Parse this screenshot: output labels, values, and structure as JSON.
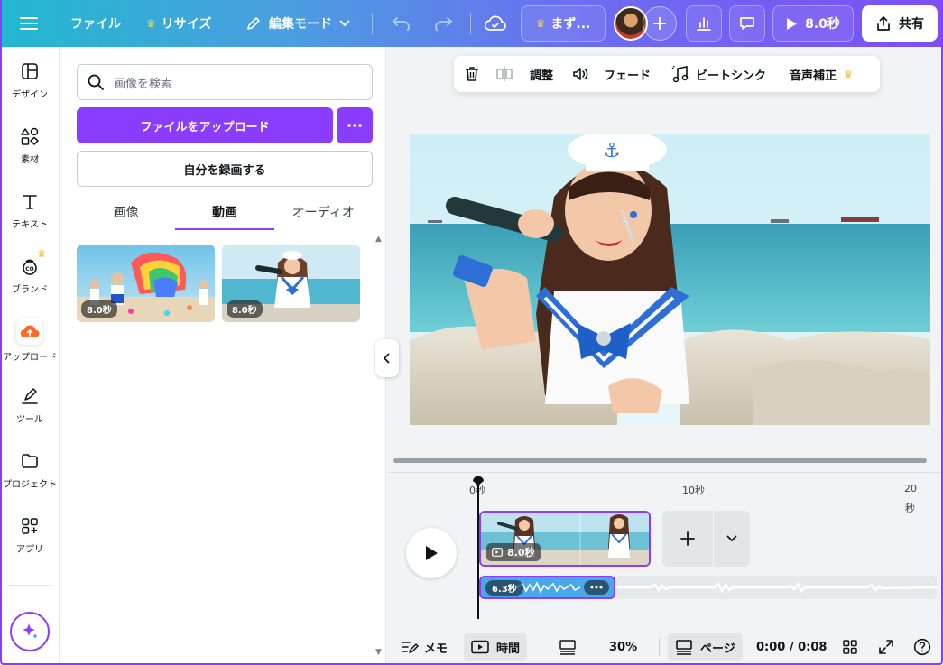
{
  "topbar": {
    "file": "ファイル",
    "resize": "リサイズ",
    "edit_mode": "編集モード",
    "design_title": "まず...",
    "duration": "8.0秒",
    "share": "共有"
  },
  "rail": {
    "items": [
      {
        "label": "デザイン",
        "icon": "layout-icon"
      },
      {
        "label": "素材",
        "icon": "shapes-icon"
      },
      {
        "label": "テキスト",
        "icon": "text-icon"
      },
      {
        "label": "ブランド",
        "icon": "brand-icon"
      },
      {
        "label": "アップロード",
        "icon": "upload-cloud-icon"
      },
      {
        "label": "ツール",
        "icon": "pen-tool-icon"
      },
      {
        "label": "プロジェクト",
        "icon": "folder-icon"
      },
      {
        "label": "アプリ",
        "icon": "apps-icon"
      }
    ]
  },
  "panel": {
    "search_placeholder": "画像を検索",
    "upload_button": "ファイルをアップロード",
    "record_button": "自分を録画する",
    "tabs": [
      {
        "label": "画像"
      },
      {
        "label": "動画"
      },
      {
        "label": "オーディオ"
      }
    ],
    "active_tab": "動画",
    "videos": [
      {
        "duration": "8.0秒"
      },
      {
        "duration": "8.0秒"
      }
    ]
  },
  "context_toolbar": {
    "adjust": "調整",
    "fade": "フェード",
    "beat_sync": "ビートシンク",
    "audio_enhance": "音声補正"
  },
  "timeline": {
    "ticks": [
      "0秒",
      "10秒",
      "20",
      "秒"
    ],
    "video_clip_duration": "8.0秒",
    "audio_clip_duration": "6.3秒"
  },
  "bottombar": {
    "notes": "メモ",
    "time": "時間",
    "zoom": "30%",
    "pages": "ページ",
    "timecode": "0:00 / 0:08"
  },
  "colors": {
    "accent": "#8b3dff",
    "audio_track": "#4aa8e8"
  }
}
